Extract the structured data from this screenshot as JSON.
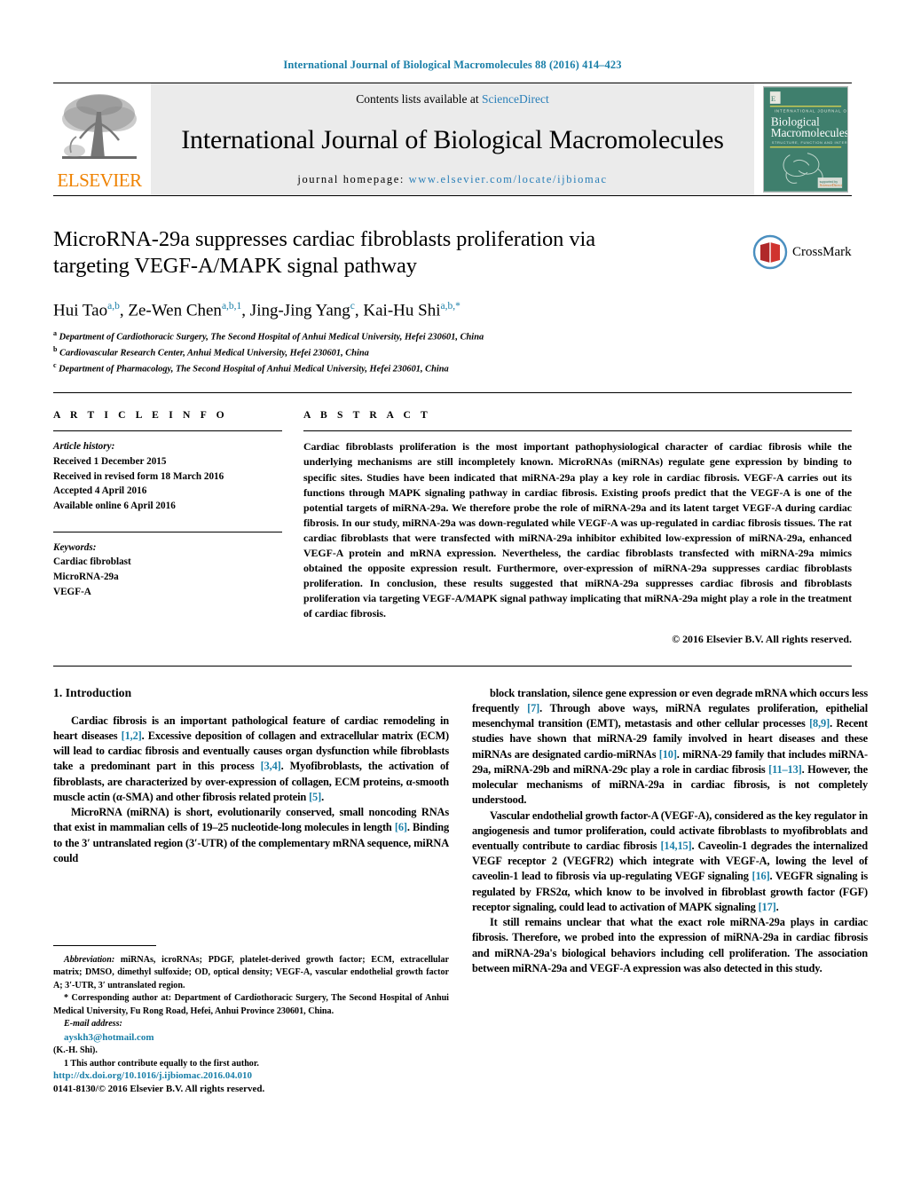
{
  "running_head": "International Journal of Biological Macromolecules 88 (2016) 414–423",
  "masthead": {
    "publisher": "ELSEVIER",
    "contents_prefix": "Contents lists available at ",
    "contents_link": "ScienceDirect",
    "journal_title": "International Journal of Biological Macromolecules",
    "homepage_prefix": "journal homepage: ",
    "homepage_url": "www.elsevier.com/locate/ijbiomac",
    "cover_line1": "INTERNATIONAL JOURNAL OF",
    "cover_line2": "Biological",
    "cover_line3": "Macromolecules",
    "cover_line4": "STRUCTURE, FUNCTION AND INTERACTIONS"
  },
  "article": {
    "title": "MicroRNA-29a suppresses cardiac fibroblasts proliferation via targeting VEGF-A/MAPK signal pathway",
    "crossmark_label": "CrossMark",
    "authors_html": "Hui Tao<sup>a,b</sup>, Ze-Wen Chen<sup>a,b,1</sup>, Jing-Jing Yang<sup>c</sup>, Kai-Hu Shi<sup>a,b,</sup><sup>*</sup>",
    "affiliations": [
      {
        "marker": "a",
        "text": "Department of Cardiothoracic Surgery, The Second Hospital of Anhui Medical University, Hefei 230601, China"
      },
      {
        "marker": "b",
        "text": "Cardiovascular Research Center, Anhui Medical University, Hefei 230601, China"
      },
      {
        "marker": "c",
        "text": "Department of Pharmacology, The Second Hospital of Anhui Medical University, Hefei 230601, China"
      }
    ]
  },
  "article_info": {
    "heading": "A R T I C L E   I N F O",
    "history_label": "Article history:",
    "history": [
      "Received 1 December 2015",
      "Received in revised form 18 March 2016",
      "Accepted 4 April 2016",
      "Available online 6 April 2016"
    ],
    "keywords_label": "Keywords:",
    "keywords": [
      "Cardiac fibroblast",
      "MicroRNA-29a",
      "VEGF-A"
    ]
  },
  "abstract": {
    "heading": "A B S T R A C T",
    "text": "Cardiac fibroblasts proliferation is the most important pathophysiological character of cardiac fibrosis while the underlying mechanisms are still incompletely known. MicroRNAs (miRNAs) regulate gene expression by binding to specific sites. Studies have been indicated that miRNA-29a play a key role in cardiac fibrosis. VEGF-A carries out its functions through MAPK signaling pathway in cardiac fibrosis. Existing proofs predict that the VEGF-A is one of the potential targets of miRNA-29a. We therefore probe the role of miRNA-29a and its latent target VEGF-A during cardiac fibrosis. In our study, miRNA-29a was down-regulated while VEGF-A was up-regulated in cardiac fibrosis tissues. The rat cardiac fibroblasts that were transfected with miRNA-29a inhibitor exhibited low-expression of miRNA-29a, enhanced VEGF-A protein and mRNA expression. Nevertheless, the cardiac fibroblasts transfected with miRNA-29a mimics obtained the opposite expression result. Furthermore, over-expression of miRNA-29a suppresses cardiac fibroblasts proliferation. In conclusion, these results suggested that miRNA-29a suppresses cardiac fibrosis and fibroblasts proliferation via targeting VEGF-A/MAPK signal pathway implicating that miRNA-29a might play a role in the treatment of cardiac fibrosis.",
    "copyright": "© 2016 Elsevier B.V. All rights reserved."
  },
  "introduction": {
    "heading": "1.  Introduction",
    "left_paragraphs": [
      "Cardiac fibrosis is an important pathological feature of cardiac remodeling in heart diseases <span class=\"ref\">[1,2]</span>. Excessive deposition of collagen and extracellular matrix (ECM) will lead to cardiac fibrosis and eventually causes organ dysfunction while fibroblasts take a predominant part in this process <span class=\"ref\">[3,4]</span>. Myofibroblasts, the activation of fibroblasts, are characterized by over-expression of collagen, ECM proteins, α-smooth muscle actin (α-SMA) and other fibrosis related protein <span class=\"ref\">[5]</span>.",
      "MicroRNA (miRNA) is short, evolutionarily conserved, small noncoding RNAs that exist in mammalian cells of 19–25 nucleotide-long molecules in length <span class=\"ref\">[6]</span>. Binding to the 3′ untranslated region (3′-UTR) of the complementary mRNA sequence, miRNA could"
    ],
    "right_paragraphs": [
      "block translation, silence gene expression or even degrade mRNA which occurs less frequently <span class=\"ref\">[7]</span>. Through above ways, miRNA regulates proliferation, epithelial mesenchymal transition (EMT), metastasis and other cellular processes <span class=\"ref\">[8,9]</span>. Recent studies have shown that miRNA-29 family involved in heart diseases and these miRNAs are designated cardio-miRNAs <span class=\"ref\">[10]</span>. miRNA-29 family that includes miRNA-29a, miRNA-29b and miRNA-29c play a role in cardiac fibrosis <span class=\"ref\">[11–13]</span>. However, the molecular mechanisms of miRNA-29a in cardiac fibrosis, is not completely understood.",
      "Vascular endothelial growth factor-A (VEGF-A), considered as the key regulator in angiogenesis and tumor proliferation, could activate fibroblasts to myofibroblats and eventually contribute to cardiac fibrosis <span class=\"ref\">[14,15]</span>. Caveolin-1 degrades the internalized VEGF receptor 2 (VEGFR2) which integrate with VEGF-A, lowing the level of caveolin-1 lead to fibrosis via up-regulating VEGF signaling <span class=\"ref\">[16]</span>. VEGFR signaling is regulated by FRS2α, which know to be involved in fibroblast growth factor (FGF) receptor signaling, could lead to activation of MAPK signaling <span class=\"ref\">[17]</span>.",
      "It still remains unclear that what the exact role miRNA-29a plays in cardiac fibrosis. Therefore, we probed into the expression of miRNA-29a in cardiac fibrosis and miRNA-29a's biological behaviors including cell proliferation. The association between miRNA-29a and VEGF-A expression was also detected in this study."
    ]
  },
  "footnotes": {
    "abbreviations": "<i>Abbreviation:</i>  miRNAs, icroRNAs; PDGF, platelet-derived growth factor; ECM, extracellular matrix; DMSO, dimethyl sulfoxide; OD, optical density; VEGF-A, vascular endothelial growth factor A; 3′-UTR, 3′ untranslated region.",
    "corresponding": "*  Corresponding author at: Department of Cardiothoracic Surgery, The Second Hospital of Anhui Medical University, Fu Rong Road, Hefei, Anhui Province 230601, China.",
    "email_label": "E-mail address:",
    "email": "ayskh3@hotmail.com",
    "email_suffix": " (K.-H. Shi).",
    "equal_contribution": "1  This author contribute equally to the first author."
  },
  "bottom": {
    "doi": "http://dx.doi.org/10.1016/j.ijbiomac.2016.04.010",
    "issn_line": "0141-8130/© 2016 Elsevier B.V. All rights reserved."
  },
  "colors": {
    "link": "#1a7fa8",
    "elsevier_orange": "#ef8200",
    "cover_green": "#3f7f6d",
    "masthead_grey": "#ebebeb"
  }
}
